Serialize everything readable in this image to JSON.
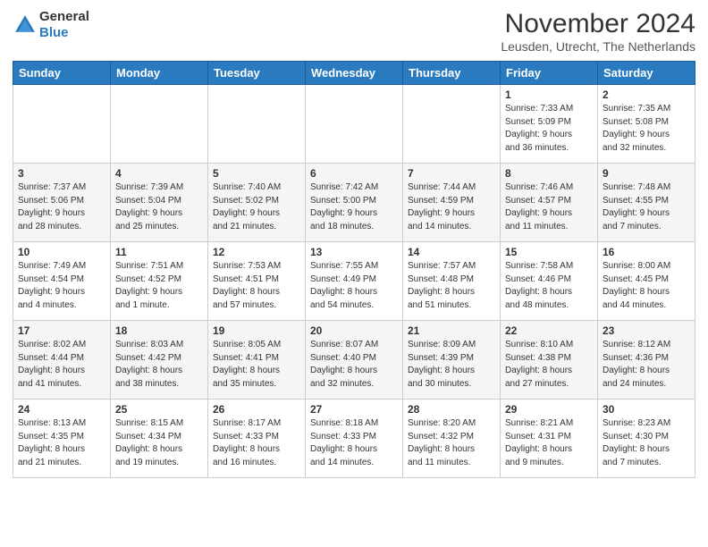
{
  "header": {
    "logo_line1": "General",
    "logo_line2": "Blue",
    "month_title": "November 2024",
    "location": "Leusden, Utrecht, The Netherlands"
  },
  "weekdays": [
    "Sunday",
    "Monday",
    "Tuesday",
    "Wednesday",
    "Thursday",
    "Friday",
    "Saturday"
  ],
  "weeks": [
    [
      {
        "day": "",
        "info": ""
      },
      {
        "day": "",
        "info": ""
      },
      {
        "day": "",
        "info": ""
      },
      {
        "day": "",
        "info": ""
      },
      {
        "day": "",
        "info": ""
      },
      {
        "day": "1",
        "info": "Sunrise: 7:33 AM\nSunset: 5:09 PM\nDaylight: 9 hours\nand 36 minutes."
      },
      {
        "day": "2",
        "info": "Sunrise: 7:35 AM\nSunset: 5:08 PM\nDaylight: 9 hours\nand 32 minutes."
      }
    ],
    [
      {
        "day": "3",
        "info": "Sunrise: 7:37 AM\nSunset: 5:06 PM\nDaylight: 9 hours\nand 28 minutes."
      },
      {
        "day": "4",
        "info": "Sunrise: 7:39 AM\nSunset: 5:04 PM\nDaylight: 9 hours\nand 25 minutes."
      },
      {
        "day": "5",
        "info": "Sunrise: 7:40 AM\nSunset: 5:02 PM\nDaylight: 9 hours\nand 21 minutes."
      },
      {
        "day": "6",
        "info": "Sunrise: 7:42 AM\nSunset: 5:00 PM\nDaylight: 9 hours\nand 18 minutes."
      },
      {
        "day": "7",
        "info": "Sunrise: 7:44 AM\nSunset: 4:59 PM\nDaylight: 9 hours\nand 14 minutes."
      },
      {
        "day": "8",
        "info": "Sunrise: 7:46 AM\nSunset: 4:57 PM\nDaylight: 9 hours\nand 11 minutes."
      },
      {
        "day": "9",
        "info": "Sunrise: 7:48 AM\nSunset: 4:55 PM\nDaylight: 9 hours\nand 7 minutes."
      }
    ],
    [
      {
        "day": "10",
        "info": "Sunrise: 7:49 AM\nSunset: 4:54 PM\nDaylight: 9 hours\nand 4 minutes."
      },
      {
        "day": "11",
        "info": "Sunrise: 7:51 AM\nSunset: 4:52 PM\nDaylight: 9 hours\nand 1 minute."
      },
      {
        "day": "12",
        "info": "Sunrise: 7:53 AM\nSunset: 4:51 PM\nDaylight: 8 hours\nand 57 minutes."
      },
      {
        "day": "13",
        "info": "Sunrise: 7:55 AM\nSunset: 4:49 PM\nDaylight: 8 hours\nand 54 minutes."
      },
      {
        "day": "14",
        "info": "Sunrise: 7:57 AM\nSunset: 4:48 PM\nDaylight: 8 hours\nand 51 minutes."
      },
      {
        "day": "15",
        "info": "Sunrise: 7:58 AM\nSunset: 4:46 PM\nDaylight: 8 hours\nand 48 minutes."
      },
      {
        "day": "16",
        "info": "Sunrise: 8:00 AM\nSunset: 4:45 PM\nDaylight: 8 hours\nand 44 minutes."
      }
    ],
    [
      {
        "day": "17",
        "info": "Sunrise: 8:02 AM\nSunset: 4:44 PM\nDaylight: 8 hours\nand 41 minutes."
      },
      {
        "day": "18",
        "info": "Sunrise: 8:03 AM\nSunset: 4:42 PM\nDaylight: 8 hours\nand 38 minutes."
      },
      {
        "day": "19",
        "info": "Sunrise: 8:05 AM\nSunset: 4:41 PM\nDaylight: 8 hours\nand 35 minutes."
      },
      {
        "day": "20",
        "info": "Sunrise: 8:07 AM\nSunset: 4:40 PM\nDaylight: 8 hours\nand 32 minutes."
      },
      {
        "day": "21",
        "info": "Sunrise: 8:09 AM\nSunset: 4:39 PM\nDaylight: 8 hours\nand 30 minutes."
      },
      {
        "day": "22",
        "info": "Sunrise: 8:10 AM\nSunset: 4:38 PM\nDaylight: 8 hours\nand 27 minutes."
      },
      {
        "day": "23",
        "info": "Sunrise: 8:12 AM\nSunset: 4:36 PM\nDaylight: 8 hours\nand 24 minutes."
      }
    ],
    [
      {
        "day": "24",
        "info": "Sunrise: 8:13 AM\nSunset: 4:35 PM\nDaylight: 8 hours\nand 21 minutes."
      },
      {
        "day": "25",
        "info": "Sunrise: 8:15 AM\nSunset: 4:34 PM\nDaylight: 8 hours\nand 19 minutes."
      },
      {
        "day": "26",
        "info": "Sunrise: 8:17 AM\nSunset: 4:33 PM\nDaylight: 8 hours\nand 16 minutes."
      },
      {
        "day": "27",
        "info": "Sunrise: 8:18 AM\nSunset: 4:33 PM\nDaylight: 8 hours\nand 14 minutes."
      },
      {
        "day": "28",
        "info": "Sunrise: 8:20 AM\nSunset: 4:32 PM\nDaylight: 8 hours\nand 11 minutes."
      },
      {
        "day": "29",
        "info": "Sunrise: 8:21 AM\nSunset: 4:31 PM\nDaylight: 8 hours\nand 9 minutes."
      },
      {
        "day": "30",
        "info": "Sunrise: 8:23 AM\nSunset: 4:30 PM\nDaylight: 8 hours\nand 7 minutes."
      }
    ]
  ]
}
